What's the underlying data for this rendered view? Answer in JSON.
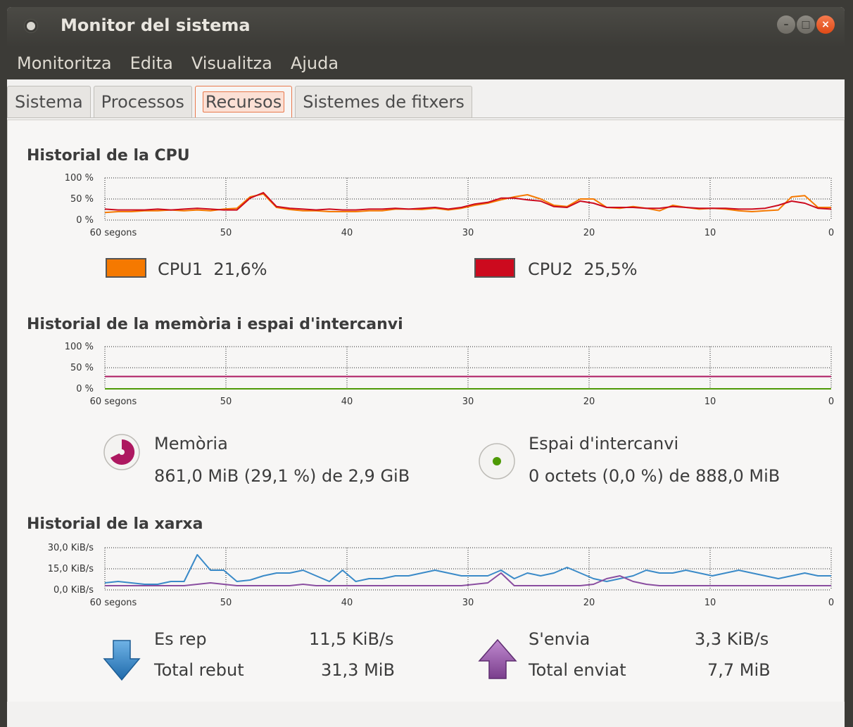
{
  "window": {
    "title": "Monitor del sistema",
    "min_label": "–",
    "max_label": "□",
    "close_label": "×"
  },
  "menu": [
    "Monitoritza",
    "Edita",
    "Visualitza",
    "Ajuda"
  ],
  "tabs": [
    {
      "label": "Sistema",
      "active": false
    },
    {
      "label": "Processos",
      "active": false
    },
    {
      "label": "Recursos",
      "active": true
    },
    {
      "label": "Sistemes de fitxers",
      "active": false
    }
  ],
  "cpu": {
    "title": "Historial de la CPU",
    "cpus": [
      {
        "label": "CPU1",
        "value": "21,6%",
        "color": "#f57900"
      },
      {
        "label": "CPU2",
        "value": "25,5%",
        "color": "#cc0a1e"
      }
    ]
  },
  "memory": {
    "title": "Historial de la memòria i espai d'intercanvi",
    "mem_label": "Memòria",
    "mem_value": "861,0 MiB (29,1 %) de 2,9 GiB",
    "mem_color": "#ad1860",
    "swap_label": "Espai d'intercanvi",
    "swap_value": "0 octets (0,0 %) de 888,0 MiB",
    "swap_color": "#4e9a06"
  },
  "network": {
    "title": "Historial de la xarxa",
    "recv_label": "Es rep",
    "recv_rate": "11,5 KiB/s",
    "recv_total_label": "Total rebut",
    "recv_total": "31,3 MiB",
    "send_label": "S'envia",
    "send_rate": "3,3 KiB/s",
    "send_total_label": "Total enviat",
    "send_total": "7,7 MiB",
    "recv_color": "#3a8ac8",
    "send_color": "#8a4ea0"
  },
  "chart_data": [
    {
      "type": "line",
      "x_ticks": [
        "60 segons",
        "50",
        "40",
        "30",
        "20",
        "10",
        "0"
      ],
      "y_ticks": [
        "100 %",
        "50 %",
        "0 %"
      ],
      "ylim": [
        0,
        100
      ],
      "series": [
        {
          "name": "CPU1",
          "color": "#f57900",
          "values": [
            18,
            20,
            20,
            22,
            22,
            24,
            22,
            24,
            22,
            26,
            28,
            55,
            62,
            30,
            25,
            22,
            22,
            20,
            20,
            20,
            22,
            22,
            26,
            26,
            25,
            28,
            24,
            28,
            35,
            40,
            48,
            55,
            60,
            50,
            35,
            32,
            50,
            50,
            30,
            28,
            32,
            28,
            22,
            35,
            30,
            26,
            28,
            26,
            22,
            20,
            22,
            24,
            55,
            58,
            30,
            30
          ]
        },
        {
          "name": "CPU2",
          "color": "#cc0a1e",
          "values": [
            26,
            24,
            24,
            24,
            26,
            24,
            26,
            28,
            26,
            24,
            24,
            52,
            65,
            32,
            28,
            26,
            24,
            26,
            24,
            24,
            26,
            26,
            28,
            26,
            28,
            30,
            26,
            30,
            38,
            42,
            52,
            52,
            48,
            45,
            32,
            30,
            45,
            40,
            30,
            30,
            30,
            28,
            28,
            32,
            30,
            28,
            28,
            28,
            26,
            26,
            28,
            35,
            45,
            40,
            28,
            26
          ]
        }
      ]
    },
    {
      "type": "line",
      "x_ticks": [
        "60 segons",
        "50",
        "40",
        "30",
        "20",
        "10",
        "0"
      ],
      "y_ticks": [
        "100 %",
        "50 %",
        "0 %"
      ],
      "ylim": [
        0,
        100
      ],
      "series": [
        {
          "name": "Memòria",
          "color": "#ad1860",
          "values": [
            29.1,
            29.1
          ]
        },
        {
          "name": "Espai d'intercanvi",
          "color": "#4e9a06",
          "values": [
            0,
            0
          ]
        }
      ]
    },
    {
      "type": "line",
      "x_ticks": [
        "60 segons",
        "50",
        "40",
        "30",
        "20",
        "10",
        "0"
      ],
      "y_ticks": [
        "30,0 KiB/s",
        "15,0 KiB/s",
        "0,0 KiB/s"
      ],
      "ylim": [
        0,
        30
      ],
      "series": [
        {
          "name": "Es rep",
          "color": "#3a8ac8",
          "values": [
            5,
            6,
            5,
            4,
            4,
            6,
            6,
            25,
            14,
            14,
            6,
            7,
            10,
            12,
            12,
            14,
            10,
            6,
            14,
            6,
            8,
            8,
            10,
            10,
            12,
            14,
            12,
            10,
            10,
            10,
            14,
            8,
            12,
            10,
            12,
            16,
            12,
            8,
            6,
            8,
            10,
            14,
            12,
            12,
            14,
            12,
            10,
            12,
            14,
            12,
            10,
            8,
            10,
            12,
            10,
            10
          ]
        },
        {
          "name": "S'envia",
          "color": "#8a4ea0",
          "values": [
            3,
            3,
            3,
            3,
            3,
            3,
            3,
            4,
            5,
            4,
            3,
            3,
            3,
            3,
            3,
            4,
            3,
            3,
            3,
            3,
            3,
            3,
            3,
            3,
            3,
            3,
            3,
            3,
            4,
            5,
            12,
            3,
            3,
            3,
            3,
            3,
            3,
            4,
            8,
            10,
            6,
            4,
            3,
            3,
            3,
            3,
            3,
            3,
            3,
            3,
            3,
            3,
            3,
            3,
            3,
            3
          ]
        }
      ]
    }
  ]
}
